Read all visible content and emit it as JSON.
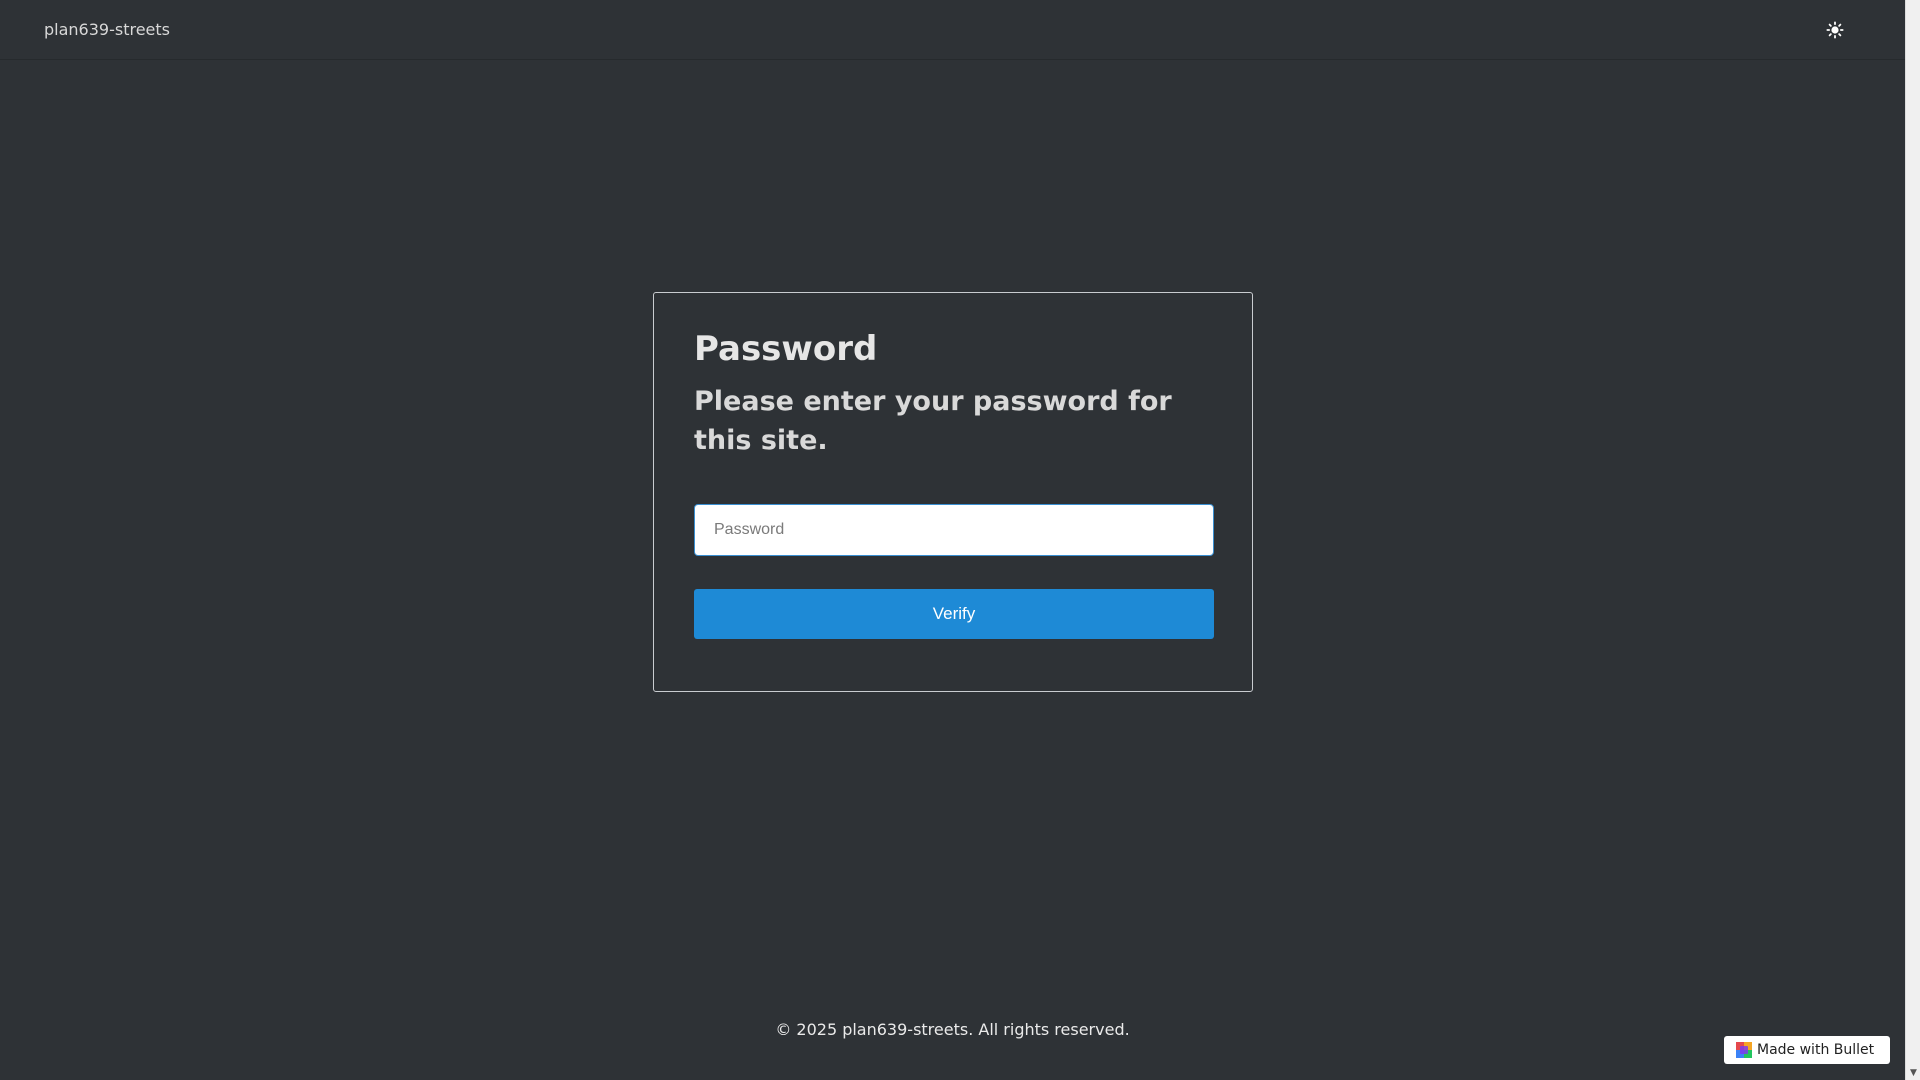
{
  "header": {
    "site_name": "plan639-streets",
    "theme_toggle_icon": "sun-icon"
  },
  "card": {
    "title": "Password",
    "subtitle": "Please enter your password for this site.",
    "password_placeholder": "Password",
    "password_value": "",
    "verify_label": "Verify"
  },
  "footer": {
    "copyright": "© 2025 plan639-streets. All rights reserved."
  },
  "badge": {
    "label": "Made with Bullet",
    "icon": "bullet-logo-icon"
  },
  "colors": {
    "background": "#2e3236",
    "button": "#1e8ad6",
    "input_border": "#3a8fd1"
  }
}
